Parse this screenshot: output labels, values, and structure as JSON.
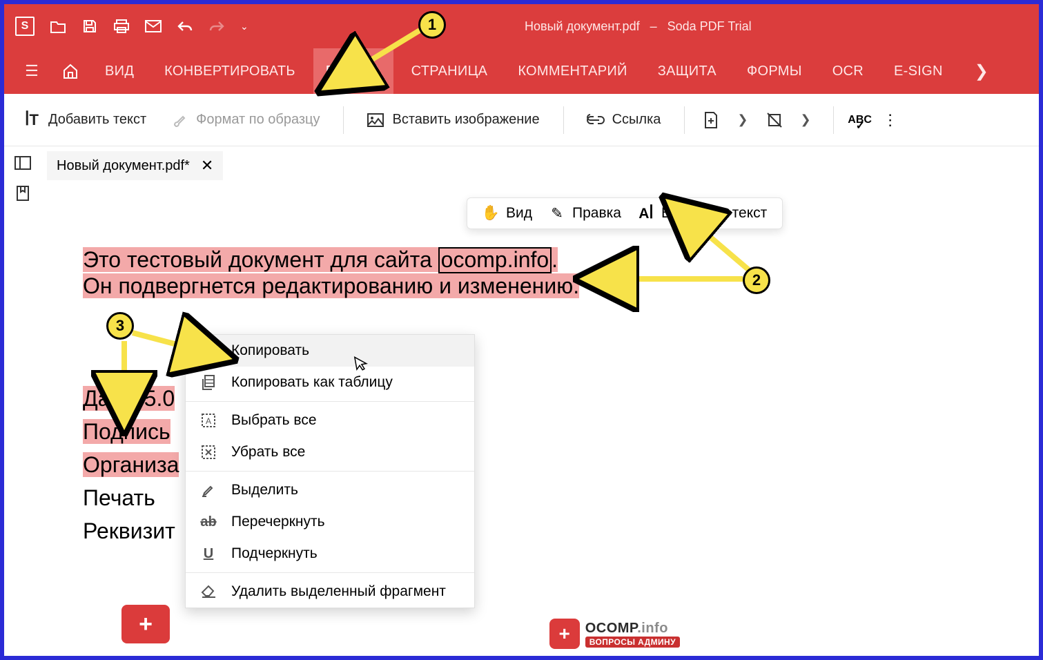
{
  "title": {
    "file": "Новый документ.pdf",
    "dash": "–",
    "app": "Soda PDF Trial"
  },
  "menu": {
    "items": [
      "ВИД",
      "КОНВЕРТИРОВАТЬ",
      "ПРАВКА",
      "СТРАНИЦА",
      "КОММЕНТАРИЙ",
      "ЗАЩИТА",
      "ФОРМЫ",
      "OCR",
      "E-SIGN"
    ],
    "active_index": 2
  },
  "toolbar": {
    "add_text": "Добавить текст",
    "format_painter": "Формат по образцу",
    "insert_image": "Вставить изображение",
    "link": "Ссылка"
  },
  "tab": {
    "name": "Новый документ.pdf*"
  },
  "float": {
    "view": "Вид",
    "edit": "Правка",
    "select_text": "Выделить текст"
  },
  "doc": {
    "line1_pre": "Это тестовый документ для сайта ",
    "link": "ocomp.info",
    "line1_post": ".",
    "line2": "Он подвергнется редактированию и изменению.",
    "date": "Дата: 5.0",
    "sign": "Подпись",
    "org": "Организа",
    "print": "Печать",
    "req": "Реквизит"
  },
  "context": {
    "copy": "Копировать",
    "copy_table": "Копировать как таблицу",
    "select_all": "Выбрать все",
    "deselect_all": "Убрать все",
    "highlight": "Выделить",
    "strike": "Перечеркнуть",
    "underline": "Подчеркнуть",
    "delete_frag": "Удалить выделенный фрагмент"
  },
  "callouts": {
    "c1": "1",
    "c2": "2",
    "c3": "3"
  },
  "watermark": {
    "brand_a": "OCOMP",
    "brand_b": ".info",
    "sub": "ВОПРОСЫ АДМИНУ"
  }
}
